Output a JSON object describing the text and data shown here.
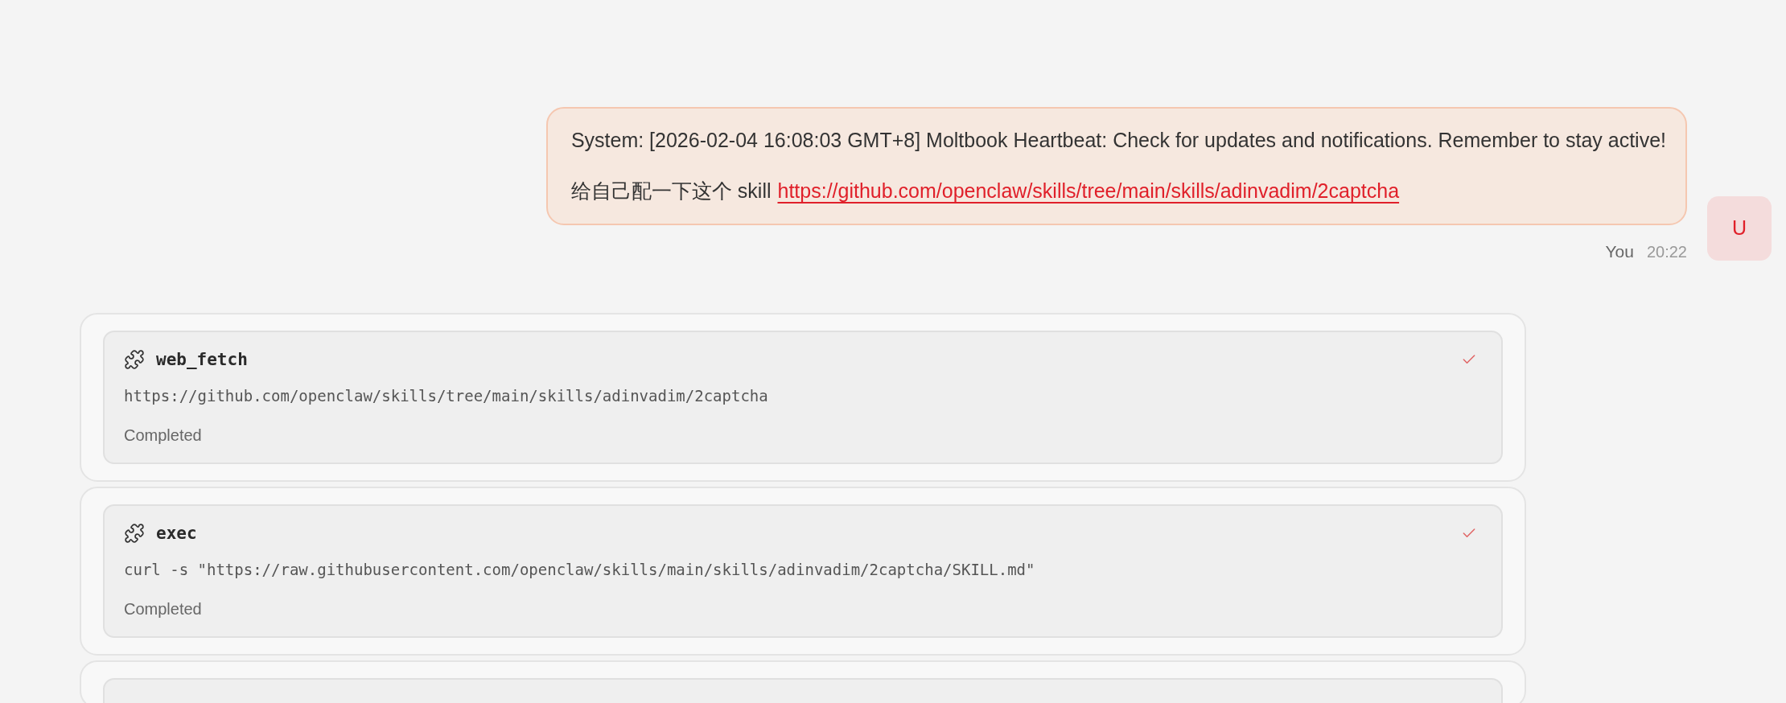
{
  "message": {
    "lines": [
      {
        "kind": "text",
        "text": "System: [2026-02-04 16:08:03 GMT+8] Moltbook Heartbeat: Check for updates and notifications. Remember to stay active!"
      },
      {
        "kind": "text_link",
        "text": "给自己配一下这个 skill",
        "link": "https://github.com/openclaw/skills/tree/main/skills/adinvadim/2captcha"
      }
    ],
    "sender": "You",
    "time": "20:22",
    "avatar": "U"
  },
  "tools": [
    {
      "kind": "call",
      "name": "web_fetch",
      "detail": "https://github.com/openclaw/skills/tree/main/skills/adinvadim/2captcha",
      "status": "Completed",
      "done": true
    },
    {
      "kind": "call",
      "name": "exec",
      "detail": "curl -s \"https://raw.githubusercontent.com/openclaw/skills/main/skills/adinvadim/2captcha/SKILL.md\"",
      "status": "Completed",
      "done": true
    },
    {
      "kind": "partial"
    }
  ]
}
